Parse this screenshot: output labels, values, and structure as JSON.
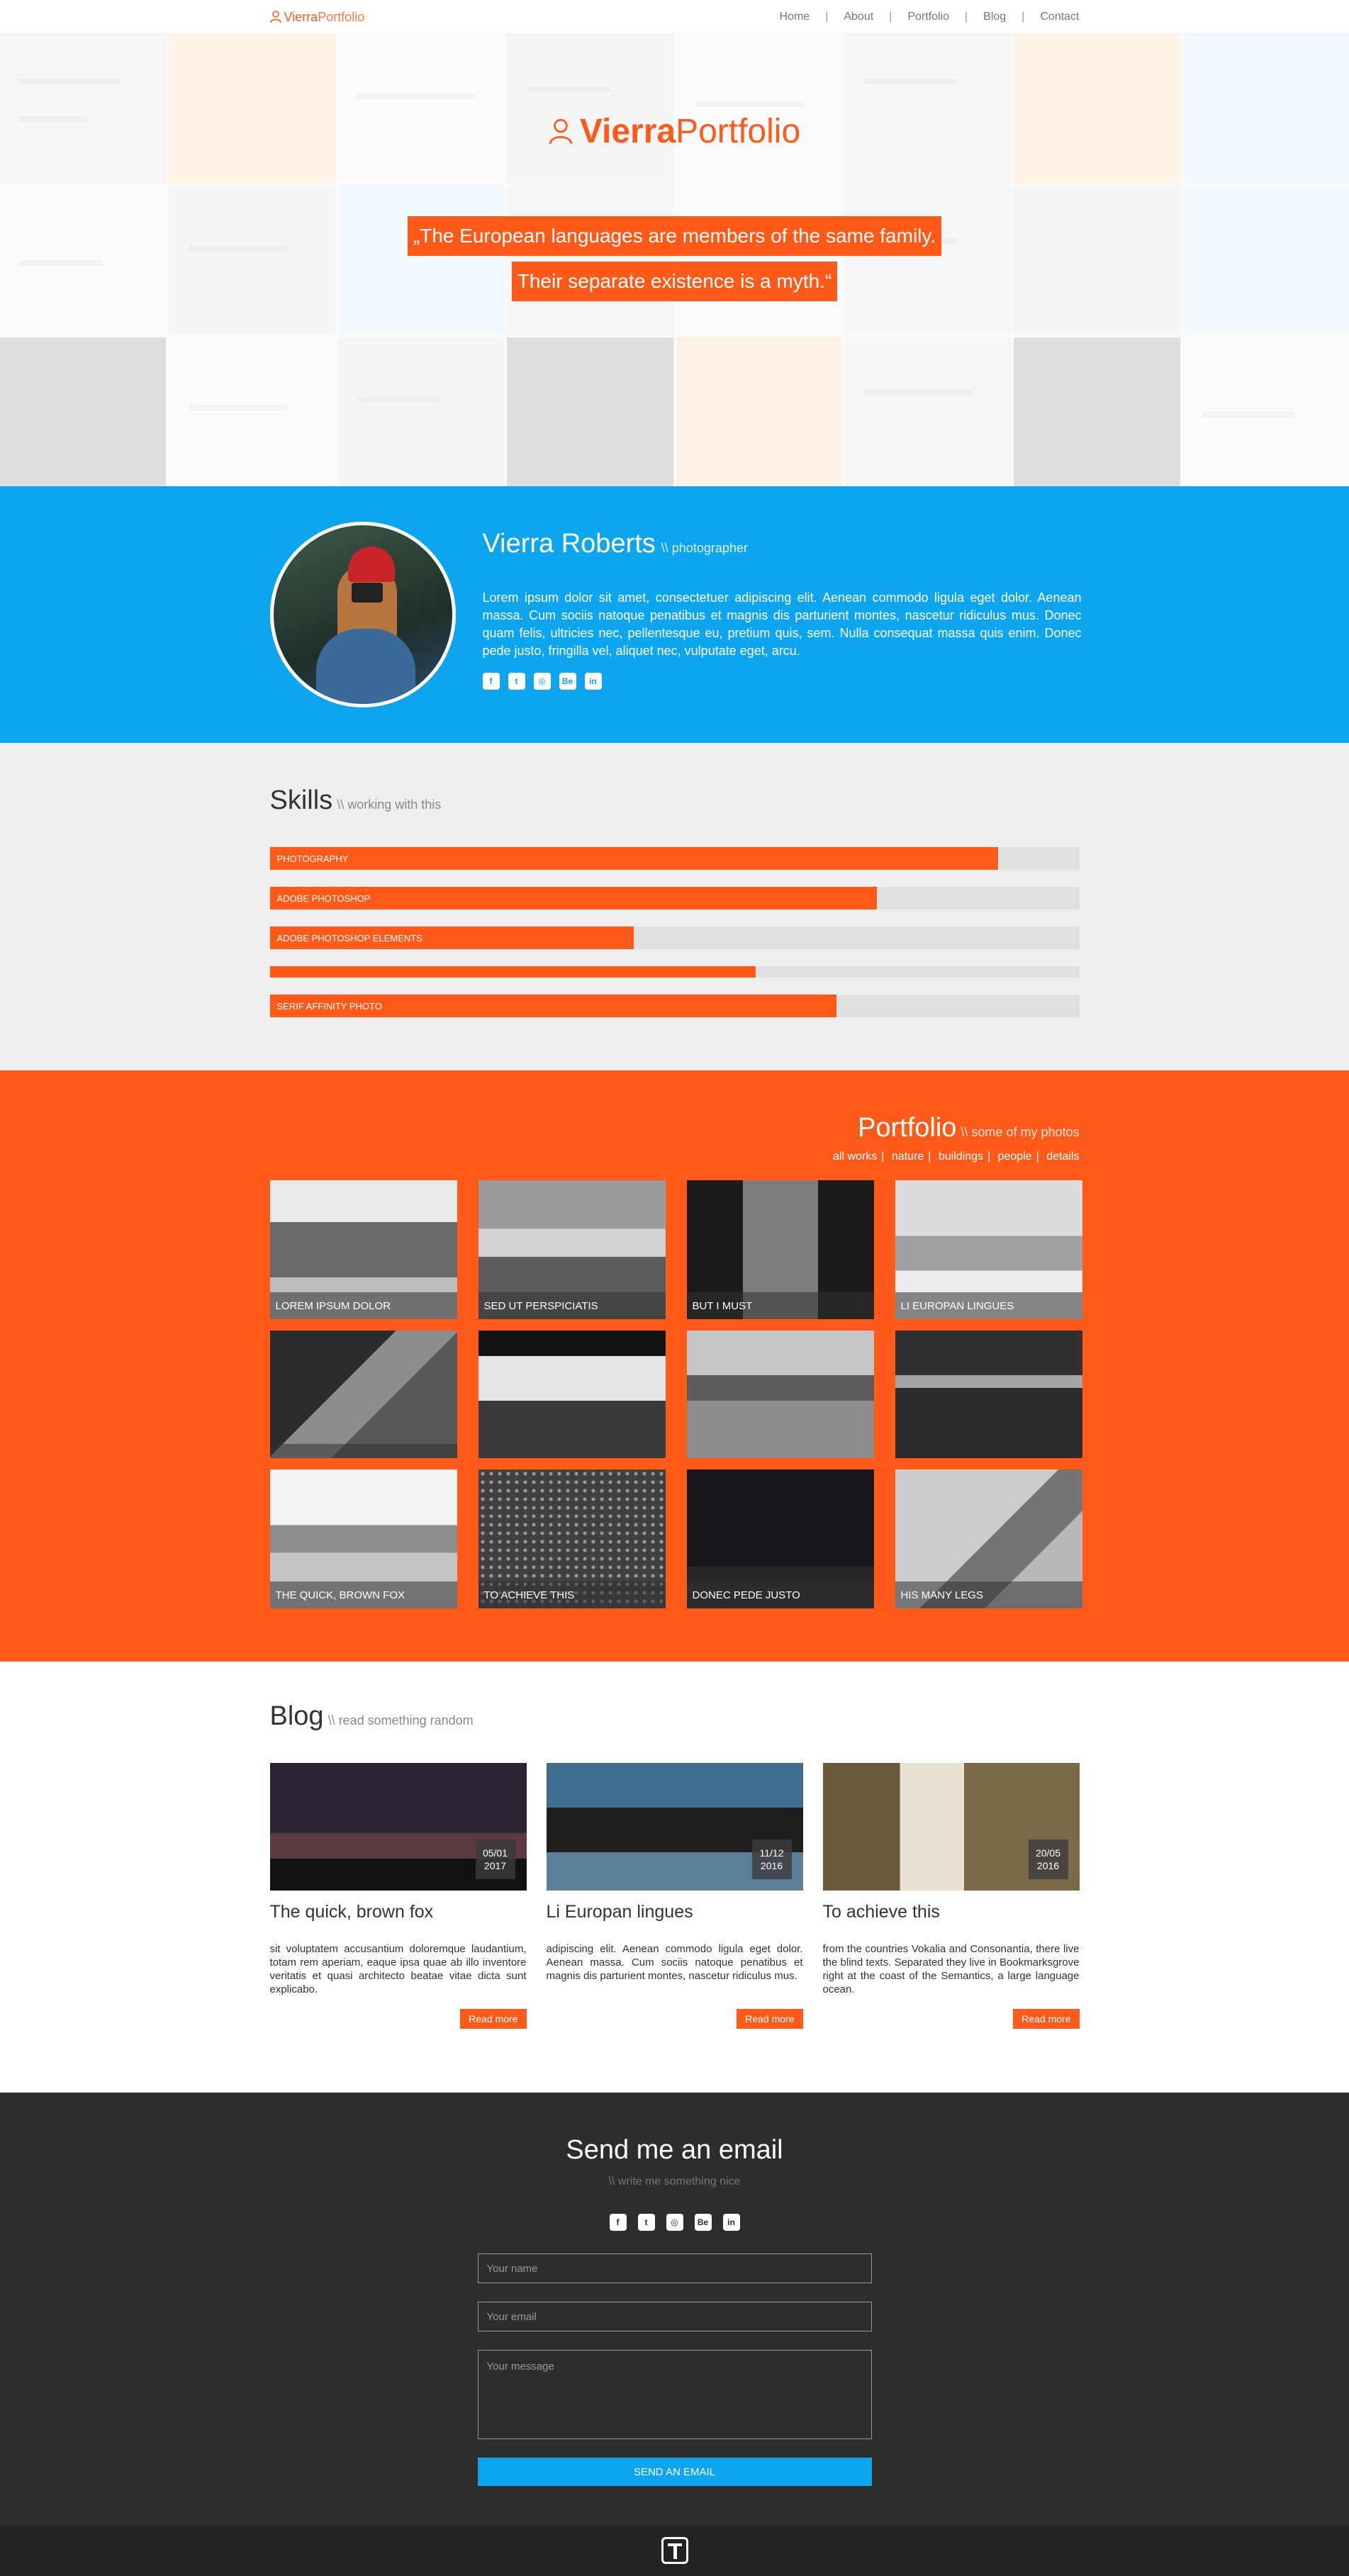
{
  "nav": {
    "logo_a": "Vierra",
    "logo_b": "Portfolio",
    "links": [
      "Home",
      "About",
      "Portfolio",
      "Blog",
      "Contact"
    ]
  },
  "hero": {
    "logo_a": "Vierra",
    "logo_b": "Portfolio",
    "quote_line1": "„The European languages are members of the same family.",
    "quote_line2": "Their separate existence is a myth.“"
  },
  "about": {
    "name": "Vierra Roberts",
    "role": "\\\\ photographer",
    "text": "Lorem ipsum dolor sit amet, consectetuer adipiscing elit. Aenean commodo ligula eget dolor. Aenean massa. Cum sociis natoque penatibus et magnis dis parturient montes, nascetur ridiculus mus. Donec quam felis, ultricies nec, pellentesque eu, pretium quis, sem. Nulla consequat massa quis enim. Donec pede justo, fringilla vel, aliquet nec, vulputate eget, arcu.",
    "socials": [
      {
        "icon": "facebook-icon",
        "glyph": "f"
      },
      {
        "icon": "twitter-icon",
        "glyph": "t"
      },
      {
        "icon": "instagram-icon",
        "glyph": "◎"
      },
      {
        "icon": "behance-icon",
        "glyph": "Be"
      },
      {
        "icon": "linkedin-icon",
        "glyph": "in"
      }
    ]
  },
  "skills": {
    "title": "Skills",
    "subtitle": "\\\\ working with this",
    "items": [
      {
        "label": "PHOTOGRAPHY",
        "level": 0.9
      },
      {
        "label": "ADOBE PHOTOSHOP",
        "level": 0.75
      },
      {
        "label": "ADOBE PHOTOSHOP ELEMENTS",
        "level": 0.45
      },
      {
        "label": "",
        "level": 0.6
      },
      {
        "label": "SERIF AFFINITY PHOTO",
        "level": 0.7
      }
    ]
  },
  "portfolio": {
    "title": "Portfolio",
    "subtitle": "\\\\ some of my photos",
    "filters": [
      "all works",
      "nature",
      "buildings",
      "people",
      "details"
    ],
    "photos": [
      {
        "caption": "LOREM IPSUM DOLOR"
      },
      {
        "caption": "SED UT PERSPICIATIS"
      },
      {
        "caption": "BUT I MUST"
      },
      {
        "caption": "LI EUROPAN LINGUES"
      },
      {
        "caption": ""
      },
      {
        "caption": ""
      },
      {
        "caption": ""
      },
      {
        "caption": ""
      },
      {
        "caption": "THE QUICK, BROWN FOX"
      },
      {
        "caption": "TO ACHIEVE THIS"
      },
      {
        "caption": "DONEC PEDE JUSTO"
      },
      {
        "caption": "HIS MANY LEGS"
      }
    ]
  },
  "blog": {
    "title": "Blog",
    "subtitle": "\\\\ read something random",
    "posts": [
      {
        "date_day": "05/01",
        "date_year": "2017",
        "title": "The quick, brown fox",
        "text": "sit voluptatem accusantium doloremque laudantium, totam rem aperiam, eaque ipsa quae ab illo inventore veritatis et quasi architecto beatae vitae dicta sunt explicabo.",
        "button": "Read more"
      },
      {
        "date_day": "11/12",
        "date_year": "2016",
        "title": "Li Europan lingues",
        "text": "adipiscing elit. Aenean commodo ligula eget dolor. Aenean massa. Cum sociis natoque penatibus et magnis dis parturient montes, nascetur ridiculus mus.",
        "button": "Read more"
      },
      {
        "date_day": "20/05",
        "date_year": "2016",
        "title": "To achieve this",
        "text": "from the countries Vokalia and Consonantia, there live the blind texts. Separated they live in Bookmarksgrove right at the coast of the Semantics, a large language ocean.",
        "button": "Read more"
      }
    ]
  },
  "contact": {
    "title": "Send me an email",
    "subtitle": "\\\\ write me something nice",
    "name_placeholder": "Your name",
    "email_placeholder": "Your email",
    "message_placeholder": "Your message",
    "send_label": "SEND AN EMAIL"
  },
  "colors": {
    "accent_orange": "#ff5a1a",
    "accent_blue": "#0ea5ef",
    "dark": "#2d2d2d"
  }
}
